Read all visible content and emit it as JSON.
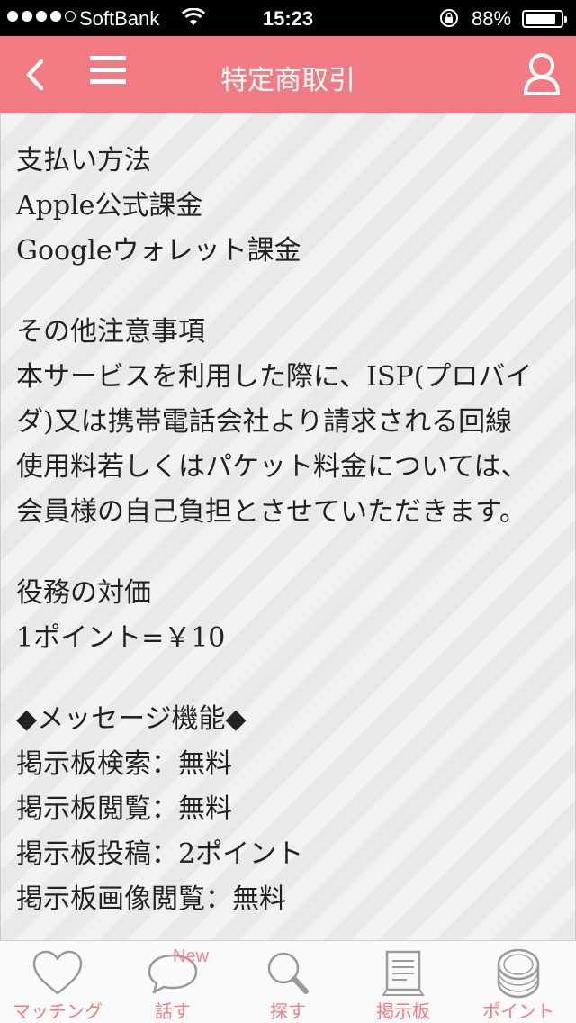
{
  "status_bar": {
    "carrier": "SoftBank",
    "time": "15:23",
    "battery": "88%",
    "battery_level": 0.88
  },
  "nav": {
    "title": "特定商取引"
  },
  "content": {
    "sections": [
      {
        "lines": [
          "支払い方法",
          "Apple公式課金",
          "Googleウォレット課金"
        ]
      },
      {
        "lines": [
          "その他注意事項",
          "本サービスを利用した際に、ISP(プロバイ",
          "ダ)又は携帯電話会社より請求される回線",
          "使用料若しくはパケット料金については、",
          "会員様の自己負担とさせていただきます。"
        ]
      },
      {
        "lines": [
          "役務の対価",
          "1ポイント=￥10"
        ]
      },
      {
        "lines": [
          "◆メッセージ機能◆",
          "掲示板検索：無料",
          "掲示板閲覧：無料",
          "掲示板投稿：2ポイント",
          "掲示板画像閲覧：無料"
        ]
      }
    ]
  },
  "tab_bar": {
    "tabs": [
      {
        "label": "マッチング",
        "icon": "heart-icon"
      },
      {
        "label": "話す",
        "icon": "speech-bubble-icon",
        "badge": "New"
      },
      {
        "label": "探す",
        "icon": "magnifier-icon"
      },
      {
        "label": "掲示板",
        "icon": "bulletin-board-icon"
      },
      {
        "label": "ポイント",
        "icon": "coins-icon"
      }
    ]
  },
  "colors": {
    "accent": "#f27a82",
    "icon_gray": "#9a9a9a"
  }
}
